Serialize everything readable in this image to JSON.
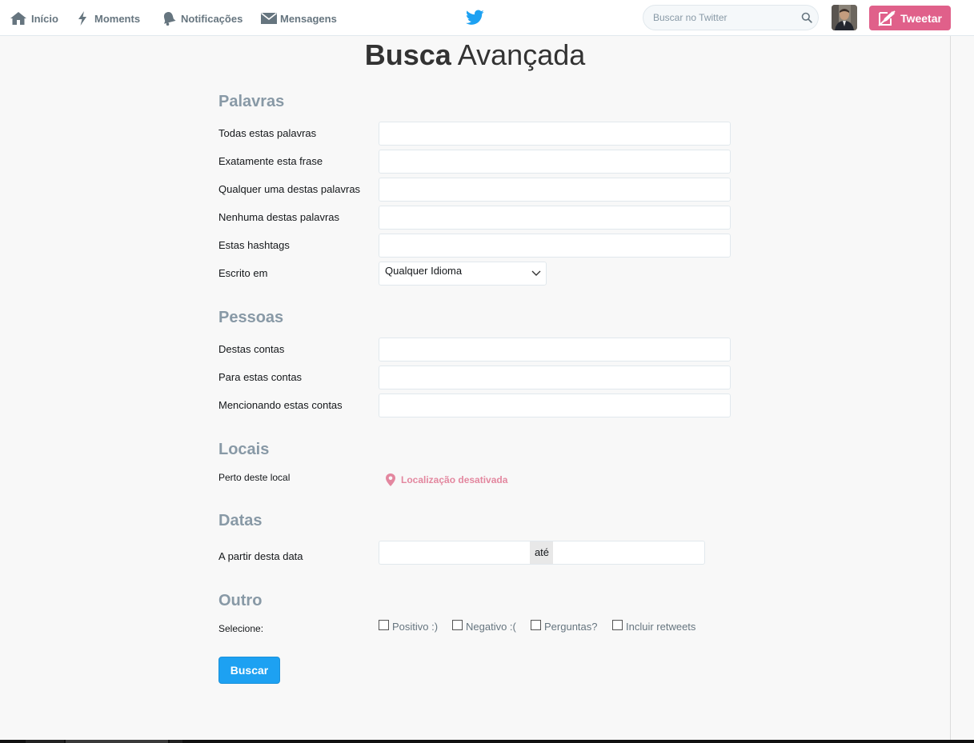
{
  "nav": {
    "home": "Início",
    "moments": "Moments",
    "notifications": "Notificações",
    "messages": "Mensagens"
  },
  "search": {
    "placeholder": "Buscar no Twitter"
  },
  "tweet_button": "Tweetar",
  "title": {
    "bold": "Busca",
    "rest": " Avançada"
  },
  "words": {
    "heading": "Palavras",
    "all": "Todas estas palavras",
    "exact": "Exatamente esta frase",
    "any": "Qualquer uma destas palavras",
    "none": "Nenhuma destas palavras",
    "hashtags": "Estas hashtags",
    "language_label": "Escrito em",
    "language_value": "Qualquer Idioma"
  },
  "people": {
    "heading": "Pessoas",
    "from": "Destas contas",
    "to": "Para estas contas",
    "mentioning": "Mencionando estas contas"
  },
  "places": {
    "heading": "Locais",
    "near": "Perto deste local",
    "location_status": "Localização desativada"
  },
  "dates": {
    "heading": "Datas",
    "since": "A partir desta data",
    "until": "até"
  },
  "other": {
    "heading": "Outro",
    "select": "Selecione:",
    "positive": "Positivo :)",
    "negative": "Negativo :(",
    "questions": "Perguntas?",
    "retweets": "Incluir retweets"
  },
  "submit": "Buscar",
  "colors": {
    "accent": "#1da1f2",
    "tweet_button": "#e0608a",
    "section_heading": "#8899a6",
    "location": "#e3879f"
  }
}
